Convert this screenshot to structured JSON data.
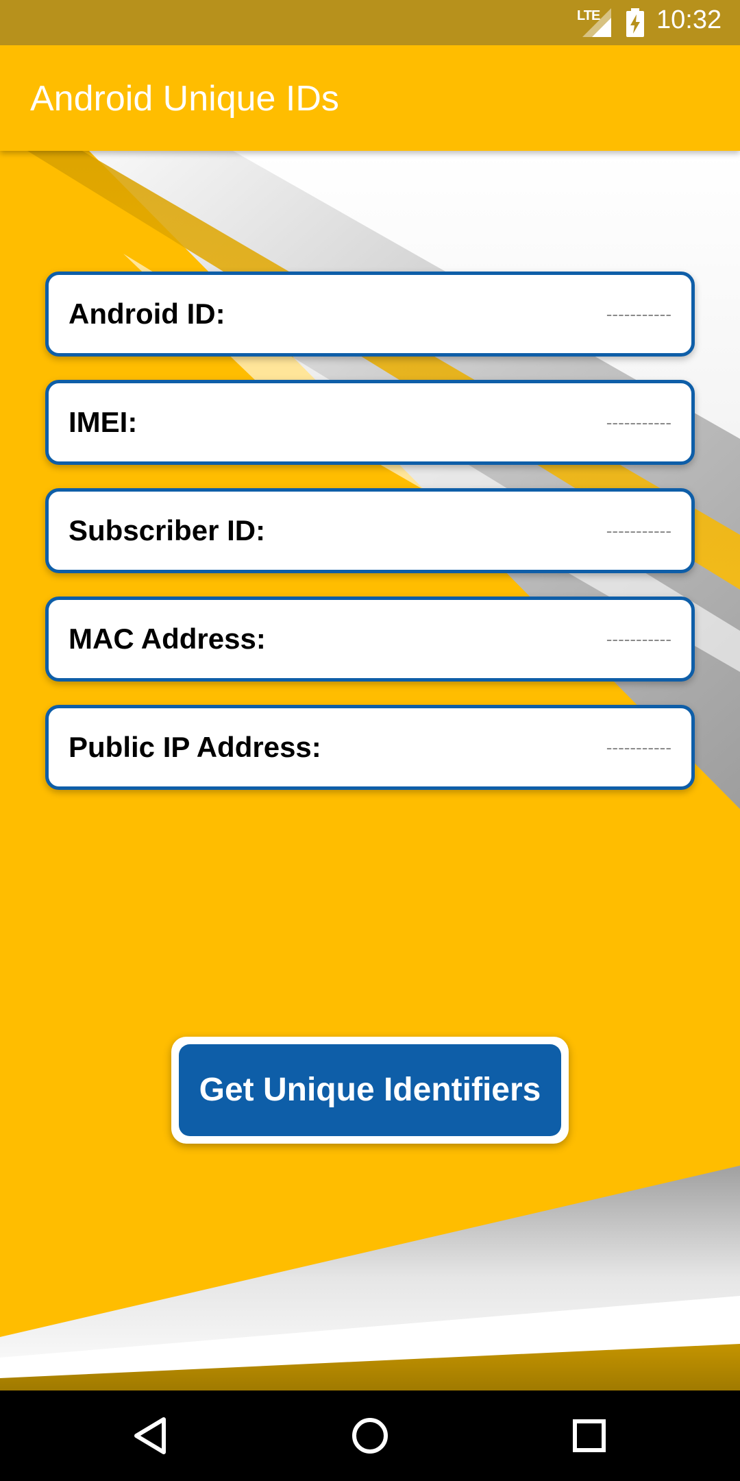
{
  "status_bar": {
    "network": "LTE",
    "time": "10:32",
    "icons": [
      "signal-icon",
      "battery-charging-icon"
    ]
  },
  "app_bar": {
    "title": "Android Unique IDs"
  },
  "fields": [
    {
      "label": "Android ID:",
      "value": "-----------"
    },
    {
      "label": "IMEI:",
      "value": "-----------"
    },
    {
      "label": "Subscriber ID:",
      "value": "-----------"
    },
    {
      "label": "MAC Address:",
      "value": "-----------"
    },
    {
      "label": "Public IP Address:",
      "value": "-----------"
    }
  ],
  "actions": {
    "get_ids_label": "Get Unique Identifiers"
  },
  "nav_bar": {
    "icons": [
      "back-icon",
      "home-icon",
      "recents-icon"
    ]
  },
  "colors": {
    "accent_yellow": "#FFBD00",
    "status_bar": "#B7911C",
    "primary_blue": "#0E5EA8",
    "card_bg": "#FFFFFF"
  }
}
